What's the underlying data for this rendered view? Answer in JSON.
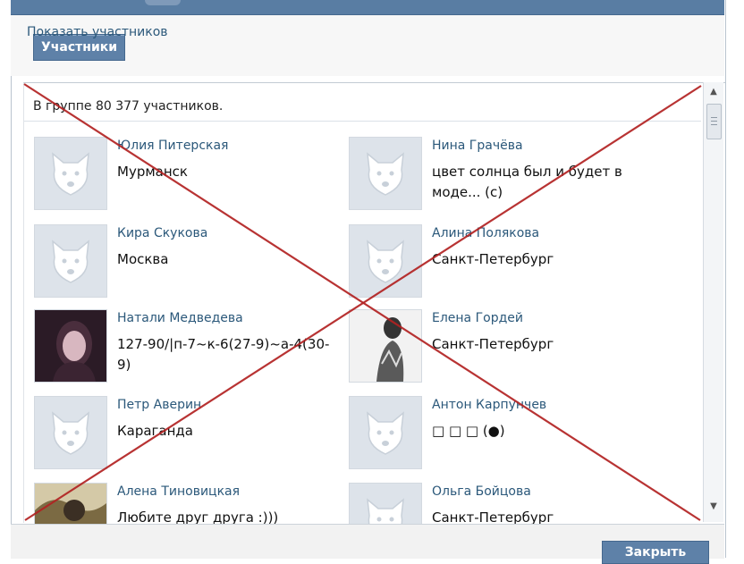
{
  "dialog": {
    "tab_label": "Участники",
    "members_count_text": "В группе 80 377 участников.",
    "footer_link": "Показать участников",
    "close_label": "Закрыть"
  },
  "members": [
    {
      "name": "Юлия Питерская",
      "status": "Мурманск",
      "avatar": "default-dog-avatar-icon"
    },
    {
      "name": "Нина Грачёва",
      "status": "цвет солнца был и будет в моде... (с)",
      "avatar": "default-dog-avatar-icon"
    },
    {
      "name": "Кира Скукова",
      "status": "Москва",
      "avatar": "default-dog-avatar-icon"
    },
    {
      "name": "Алина Полякова",
      "status": "Санкт-Петербург",
      "avatar": "default-dog-avatar-icon"
    },
    {
      "name": "Натали Медведева",
      "status": "127-90/|п-7~к-6(27-9)~а-4(30-9)",
      "avatar": "photo-avatar-icon"
    },
    {
      "name": "Елена Гордей",
      "status": "Санкт-Петербург",
      "avatar": "photo-avatar-icon"
    },
    {
      "name": "Петр Аверин",
      "status": "Караганда",
      "avatar": "default-dog-avatar-icon"
    },
    {
      "name": "Антон Карпунчев",
      "status": "□ □ □ (●)",
      "avatar": "default-dog-avatar-icon"
    },
    {
      "name": "Алена Тиновицкая",
      "status": "Любите друг друга :)))",
      "avatar": "photo-avatar-icon"
    },
    {
      "name": "Ольга Бойцова",
      "status": "Санкт-Петербург",
      "avatar": "default-dog-avatar-icon"
    }
  ],
  "colors": {
    "header_blue": "#597da3",
    "button_blue": "#5e81a8",
    "link_blue": "#2b587a",
    "cross_red": "#b22222"
  }
}
